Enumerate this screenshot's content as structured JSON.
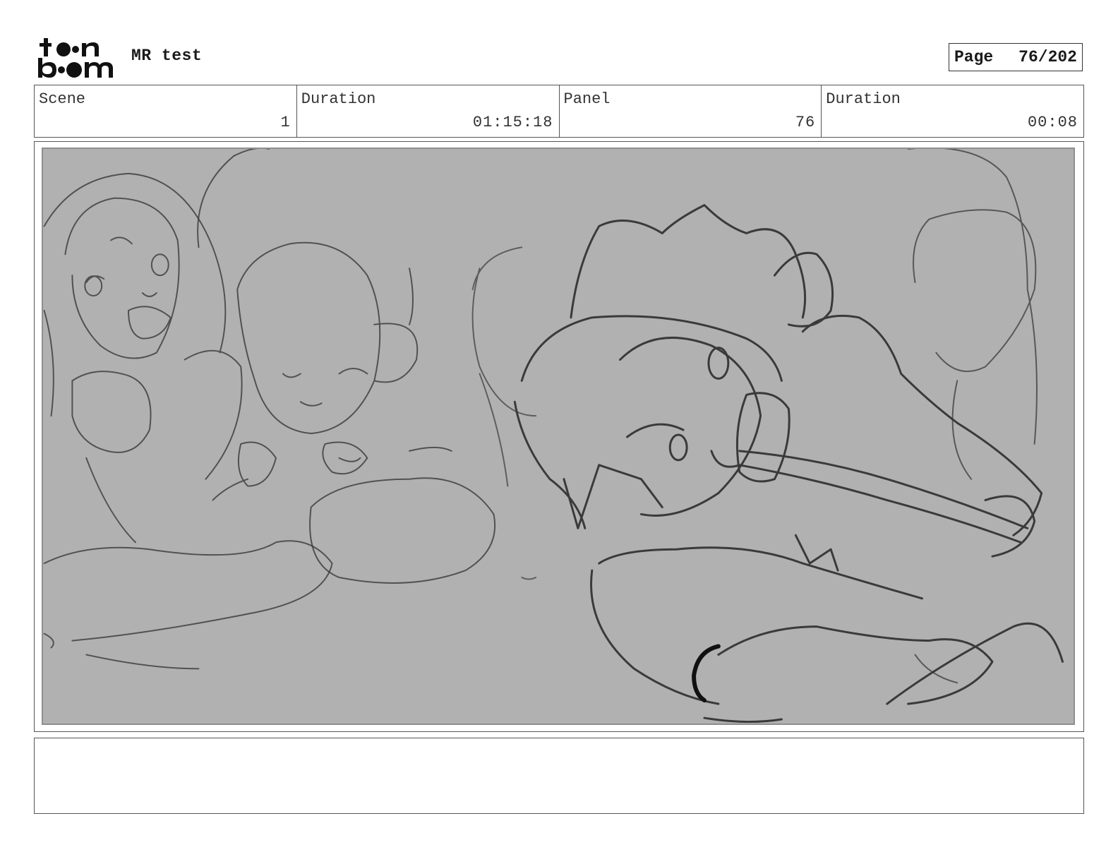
{
  "header": {
    "logo_text": "toonboom",
    "project_title": "MR test",
    "page_label": "Page",
    "page_value": "76/202"
  },
  "info": [
    {
      "label": "Scene",
      "value": "1"
    },
    {
      "label": "Duration",
      "value": "01:15:18"
    },
    {
      "label": "Panel",
      "value": "76"
    },
    {
      "label": "Duration",
      "value": "00:08"
    }
  ],
  "panel": {
    "background_color": "#b1b1b1",
    "stroke_color": "#3a3a3a"
  },
  "notes": {
    "text": ""
  }
}
